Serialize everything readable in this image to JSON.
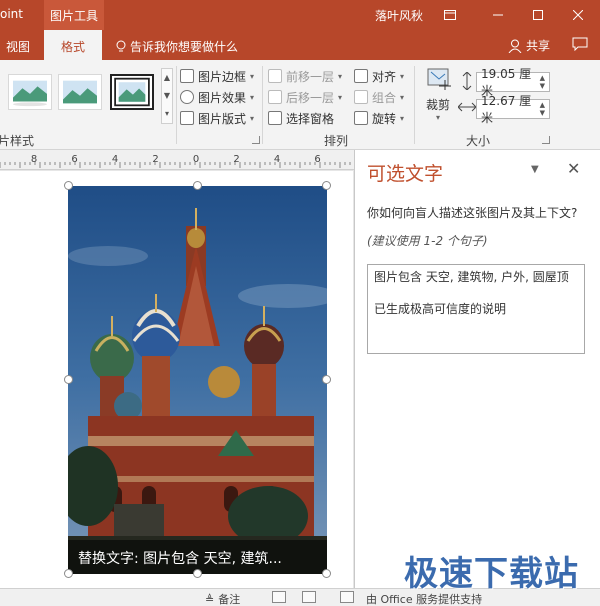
{
  "titlebar": {
    "app_name": "oint",
    "context_tab": "图片工具",
    "user_name": "落叶风秋"
  },
  "tabs": {
    "view": "视图",
    "format": "格式",
    "tell_me": "告诉我你想要做什么",
    "share": "共享"
  },
  "ribbon": {
    "picture_border": "图片边框",
    "picture_effects": "图片效果",
    "picture_layout": "图片版式",
    "bring_forward": "前移一层",
    "send_backward": "后移一层",
    "selection_pane": "选择窗格",
    "align": "对齐",
    "group": "组合",
    "rotate": "旋转",
    "crop": "裁剪",
    "height_value": "19.05 厘米",
    "width_value": "12.67 厘米",
    "group_styles": "图片样式",
    "group_arrange": "排列",
    "group_size": "大小"
  },
  "ruler": {
    "labels": [
      "8",
      "6",
      "4",
      "2",
      "0",
      "2",
      "4",
      "6"
    ]
  },
  "slide": {
    "caption": "替换文字: 图片包含 天空, 建筑..."
  },
  "pane": {
    "title": "可选文字",
    "question": "你如何向盲人描述这张图片及其上下文?",
    "hint": "(建议使用 1-2 个句子)",
    "description": "图片包含 天空, 建筑物, 户外, 圆屋顶",
    "confidence": "已生成极高可信度的说明"
  },
  "statusbar": {
    "notes": "备注",
    "office_support": "由 Office 服务提供支持"
  },
  "watermark": {
    "text": "极速下载站"
  },
  "colors": {
    "accent": "#b7472a",
    "pane_title": "#c0502e",
    "watermark": "#2b5fa8"
  }
}
